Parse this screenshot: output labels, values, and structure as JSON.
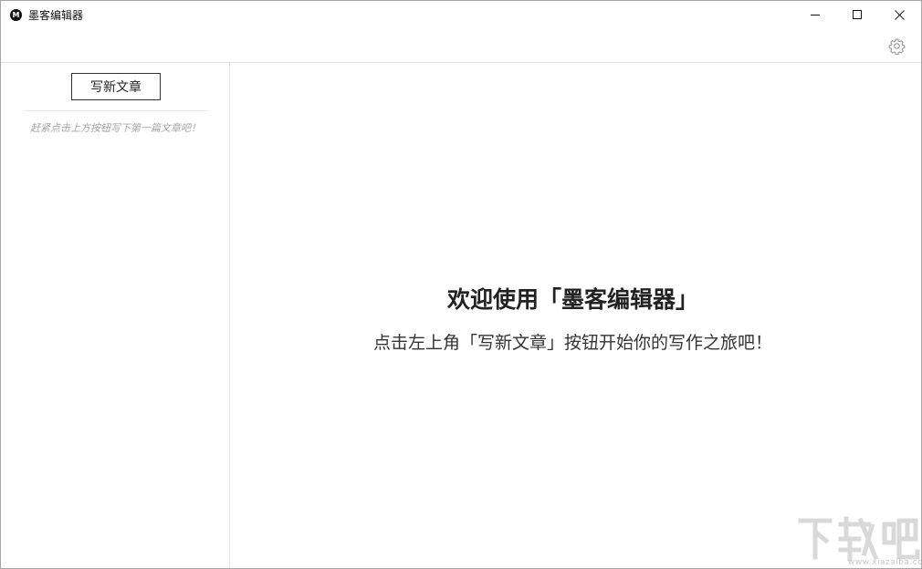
{
  "window": {
    "title": "墨客编辑器",
    "app_icon_letter": "M"
  },
  "sidebar": {
    "new_article_label": "写新文章",
    "hint": "赶紧点击上方按钮写下第一篇文章吧！"
  },
  "main": {
    "welcome_title": "欢迎使用「墨客编辑器」",
    "welcome_subtitle": "点击左上角「写新文章」按钮开始你的写作之旅吧！"
  },
  "watermark": {
    "text": "下载吧",
    "url": "www.xiazaiba.com"
  },
  "colors": {
    "border": "#e3e3e3",
    "hint_text": "#a6a6a6",
    "watermark": "#d6d6d6"
  }
}
